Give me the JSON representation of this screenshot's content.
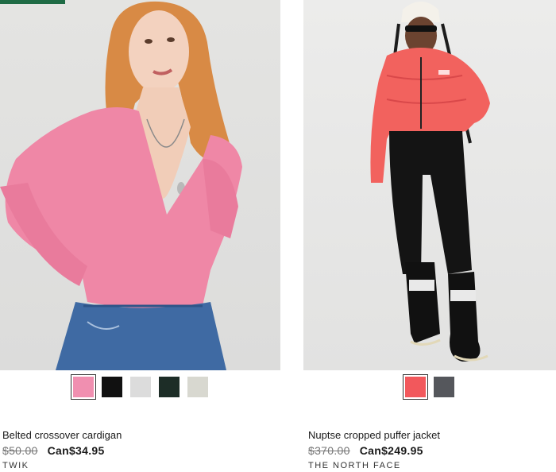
{
  "products": [
    {
      "title": "Belted crossover cardigan",
      "old_price": "$50.00",
      "new_price": "Can$34.95",
      "brand": "TWIK",
      "swatches": [
        {
          "color": "#f08fb0",
          "selected": true
        },
        {
          "color": "#111111",
          "selected": false
        },
        {
          "color": "#dcdcdc",
          "selected": false
        },
        {
          "color": "#1d2d27",
          "selected": false
        },
        {
          "color": "#d8d8d0",
          "selected": false
        }
      ]
    },
    {
      "title": "Nuptse cropped puffer jacket",
      "old_price": "$370.00",
      "new_price": "Can$249.95",
      "brand": "THE NORTH FACE",
      "swatches": [
        {
          "color": "#f2585c",
          "selected": true
        },
        {
          "color": "#55575c",
          "selected": false
        }
      ]
    }
  ]
}
